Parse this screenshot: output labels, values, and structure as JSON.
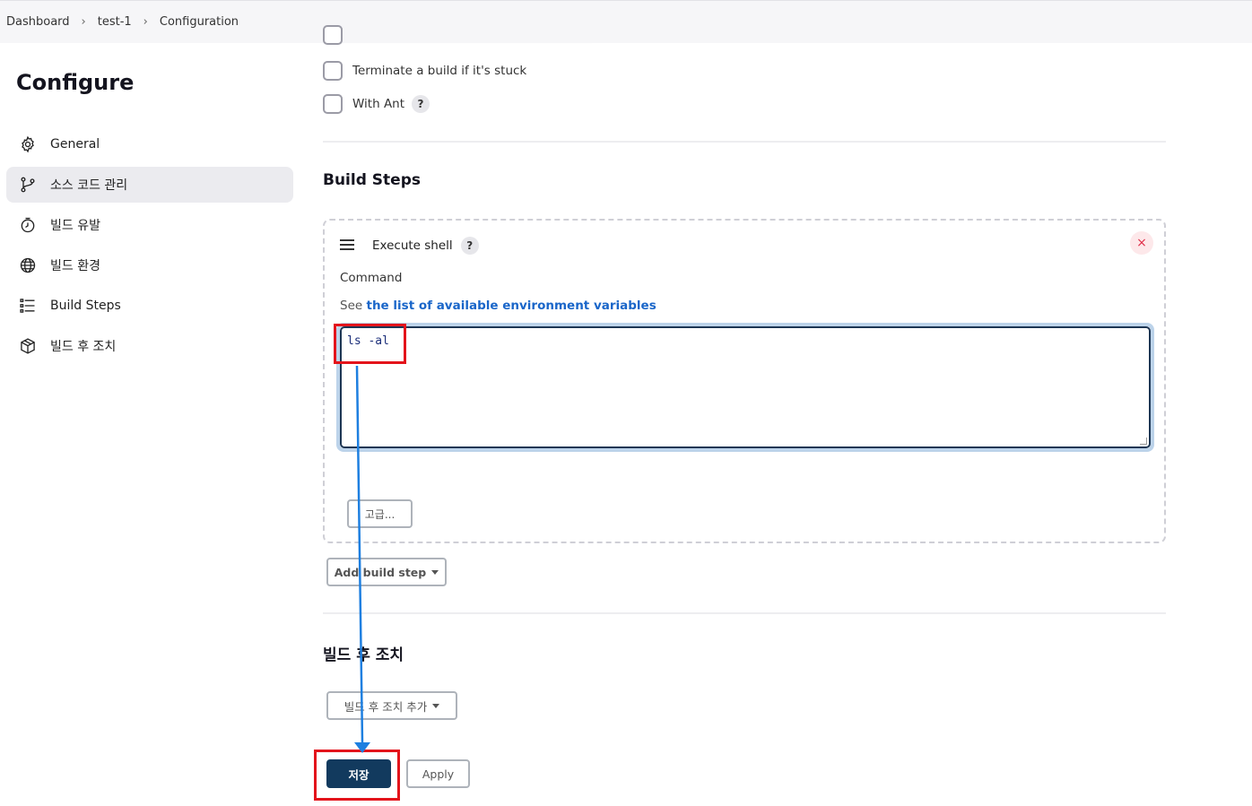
{
  "breadcrumb": {
    "items": [
      "Dashboard",
      "test-1",
      "Configuration"
    ]
  },
  "sidebar": {
    "title": "Configure",
    "items": [
      {
        "label": "General",
        "icon": "gear-icon"
      },
      {
        "label": "소스 코드 관리",
        "icon": "git-branch-icon",
        "active": true
      },
      {
        "label": "빌드 유발",
        "icon": "clock-icon"
      },
      {
        "label": "빌드 환경",
        "icon": "globe-icon"
      },
      {
        "label": "Build Steps",
        "icon": "list-icon"
      },
      {
        "label": "빌드 후 조치",
        "icon": "package-icon"
      }
    ]
  },
  "options": {
    "terminate_label": "Terminate a build if it's stuck",
    "with_ant_label": "With Ant",
    "help_glyph": "?"
  },
  "build_steps": {
    "title": "Build Steps",
    "step": {
      "name": "Execute shell",
      "help_glyph": "?",
      "close_glyph": "×",
      "command_label": "Command",
      "env_prefix": "See",
      "env_link": "the list of available environment variables",
      "command_value": "ls -al",
      "advanced_label": "고급..."
    },
    "add_step_label": "Add build step"
  },
  "post_build": {
    "title": "빌드 후 조치",
    "add_action_label": "빌드 후 조치 추가"
  },
  "actions": {
    "save_label": "저장",
    "apply_label": "Apply"
  },
  "colors": {
    "save_bg": "#123a5e",
    "link": "#1a66c9",
    "highlight": "#e3141b",
    "arrow": "#1e7fe0"
  }
}
